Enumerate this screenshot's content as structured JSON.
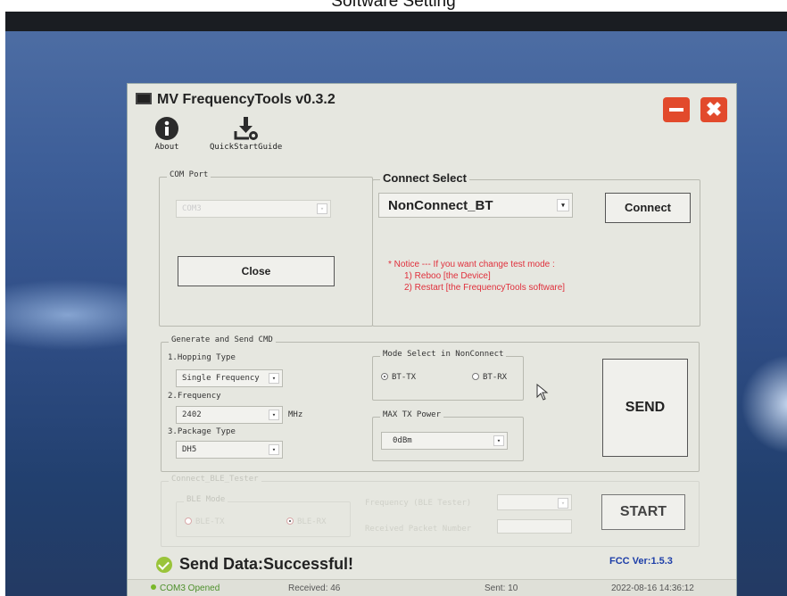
{
  "caption": "Software Setting",
  "window": {
    "title": "MV FrequencyTools v0.3.2",
    "close_glyph": "✖"
  },
  "toolbar": {
    "about_label": "About",
    "guide_label": "QuickStartGuide"
  },
  "com_port": {
    "legend": "COM Port",
    "selected": "COM3",
    "close_button": "Close"
  },
  "connect_select": {
    "legend": "Connect Select",
    "selected": "NonConnect_BT",
    "connect_button": "Connect",
    "notice": [
      "* Notice --- If you want change test mode :",
      "1) Reboo [the Device]",
      "2) Restart [the FrequencyTools software]"
    ]
  },
  "generate": {
    "legend": "Generate and Send CMD",
    "hopping_label": "1.Hopping Type",
    "hopping_value": "Single Frequency",
    "frequency_label": "2.Frequency",
    "frequency_value": "2402",
    "frequency_unit": "MHz",
    "package_label": "3.Package Type",
    "package_value": "DH5",
    "mode_legend": "Mode Select in NonConnect",
    "mode_options": [
      "BT-TX",
      "BT-RX"
    ],
    "mode_selected": "BT-TX",
    "power_legend": "MAX TX Power",
    "power_value": "0dBm",
    "send_button": "SEND"
  },
  "ble": {
    "legend": "Connect_BLE_Tester",
    "mode_legend": "BLE Mode",
    "mode_options": [
      "BLE-TX",
      "BLE-RX"
    ],
    "mode_selected": "BLE-RX",
    "frequency_label": "Frequency (BLE Tester)",
    "received_label": "Received Packet Number",
    "start_button": "START"
  },
  "status": {
    "message": "Send Data:Successful!",
    "fcc_version": "FCC Ver:1.5.3"
  },
  "statusbar": {
    "port_state": "COM3 Opened",
    "received": "Received: 46",
    "sent": "Sent: 10",
    "datetime": "2022-08-16 14:36:12"
  },
  "colors": {
    "window_bg": "#e6e7e0",
    "title_button": "#e24a2c",
    "notice_text": "#e0303c",
    "fcc_text": "#1d3ea8",
    "success_icon": "#9ac43a",
    "port_opened": "#4c8f2a"
  },
  "icons": [
    "info-icon",
    "download-gear-icon",
    "minimize-icon",
    "close-icon",
    "check-circle-icon",
    "chevron-down-icon"
  ]
}
